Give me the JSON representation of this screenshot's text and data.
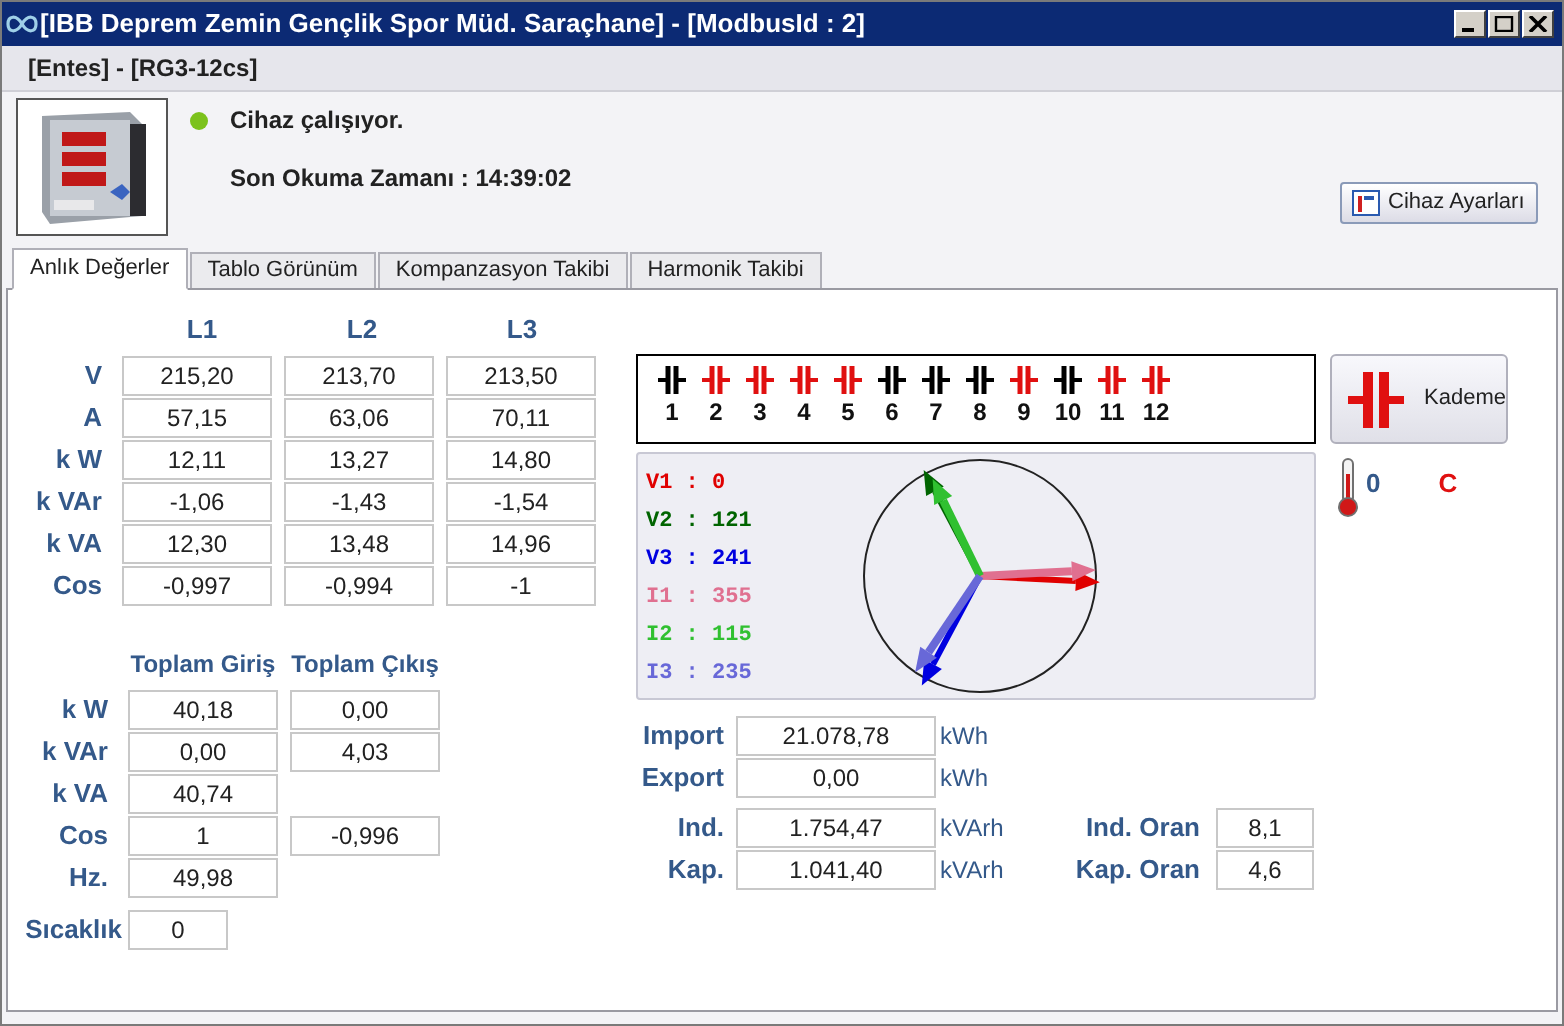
{
  "window": {
    "title": "[IBB Deprem Zemin Gençlik Spor Müd. Saraçhane] - [ModbusId : 2]"
  },
  "device": {
    "header": "[Entes] - [RG3-12cs]",
    "status": {
      "text": "Cihaz çalışıyor.",
      "on": true
    },
    "last_read": "Son Okuma Zamanı : 14:39:02",
    "settings_button": "Cihaz Ayarları"
  },
  "tabs": [
    {
      "label": "Anlık Değerler",
      "selected": true
    },
    {
      "label": "Tablo Görünüm",
      "selected": false
    },
    {
      "label": "Kompanzasyon Takibi",
      "selected": false
    },
    {
      "label": "Harmonik Takibi",
      "selected": false
    }
  ],
  "phase_table": {
    "columns": [
      "L1",
      "L2",
      "L3"
    ],
    "rows": [
      {
        "label": "V",
        "values": [
          "215,20",
          "213,70",
          "213,50"
        ]
      },
      {
        "label": "A",
        "values": [
          "57,15",
          "63,06",
          "70,11"
        ]
      },
      {
        "label": "k W",
        "values": [
          "12,11",
          "13,27",
          "14,80"
        ]
      },
      {
        "label": "k VAr",
        "values": [
          "-1,06",
          "-1,43",
          "-1,54"
        ]
      },
      {
        "label": "k VA",
        "values": [
          "12,30",
          "13,48",
          "14,96"
        ]
      },
      {
        "label": "Cos",
        "values": [
          "-0,997",
          "-0,994",
          "-1"
        ]
      }
    ]
  },
  "totals": {
    "columns": [
      "Toplam Giriş",
      "Toplam Çıkış"
    ],
    "rows": [
      {
        "label": "k W",
        "values": [
          "40,18",
          "0,00"
        ]
      },
      {
        "label": "k VAr",
        "values": [
          "0,00",
          "4,03"
        ]
      },
      {
        "label": "k VA",
        "values": [
          "40,74"
        ]
      },
      {
        "label": "Cos",
        "values": [
          "1",
          "-0,996"
        ]
      },
      {
        "label": "Hz.",
        "values": [
          "49,98"
        ]
      }
    ]
  },
  "temperature": {
    "label": "Sıcaklık",
    "value": "0"
  },
  "steps": [
    {
      "label": "1",
      "on": false
    },
    {
      "label": "2",
      "on": true
    },
    {
      "label": "3",
      "on": true
    },
    {
      "label": "4",
      "on": true
    },
    {
      "label": "5",
      "on": true
    },
    {
      "label": "6",
      "on": false
    },
    {
      "label": "7",
      "on": false
    },
    {
      "label": "8",
      "on": false
    },
    {
      "label": "9",
      "on": true
    },
    {
      "label": "10",
      "on": false
    },
    {
      "label": "11",
      "on": true
    },
    {
      "label": "12",
      "on": true
    }
  ],
  "kademe_button": "Kademe",
  "phasors": [
    {
      "label": "V1 : 0",
      "color": "#e00000"
    },
    {
      "label": "V2 : 121",
      "color": "#006400"
    },
    {
      "label": "V3 : 241",
      "color": "#0000e0"
    },
    {
      "label": "I1 : 355",
      "color": "#e07090"
    },
    {
      "label": "I2 : 115",
      "color": "#30c030"
    },
    {
      "label": "I3 : 235",
      "color": "#6868d8"
    }
  ],
  "thermometer": {
    "value": "0",
    "unit": "C"
  },
  "energy": {
    "active": [
      {
        "label": "Import",
        "value": "21.078,78",
        "unit": "kWh"
      },
      {
        "label": "Export",
        "value": "0,00",
        "unit": "kWh"
      }
    ],
    "reactive": [
      {
        "label": "Ind.",
        "value": "1.754,47",
        "unit": "kVArh",
        "ratio_label": "Ind. Oran",
        "ratio_value": "8,1"
      },
      {
        "label": "Kap.",
        "value": "1.041,40",
        "unit": "kVArh",
        "ratio_label": "Kap. Oran",
        "ratio_value": "4,6"
      }
    ]
  }
}
